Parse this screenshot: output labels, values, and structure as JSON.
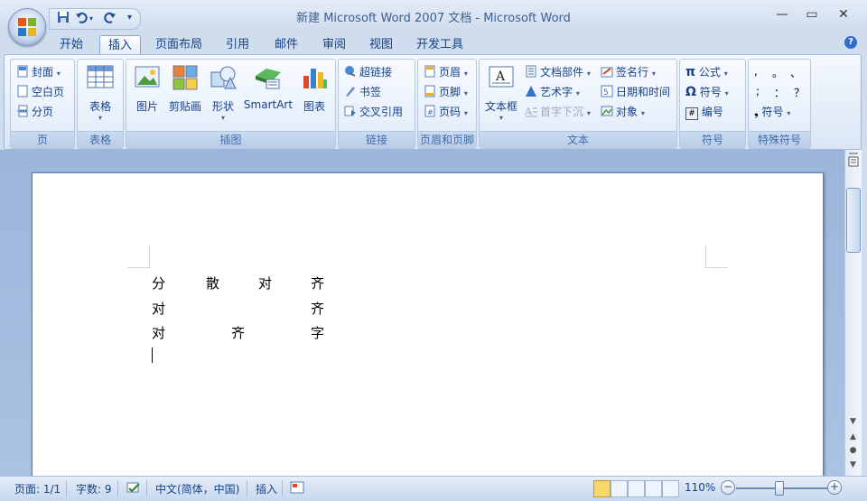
{
  "app": {
    "title": "新建 Microsoft Word 2007 文档 - Microsoft Word"
  },
  "qat": {
    "customize_glyph": "▾"
  },
  "window": {
    "minimize": "—",
    "restore": "▭",
    "close": "✕"
  },
  "tabs": [
    {
      "label": "开始"
    },
    {
      "label": "插入",
      "active": true
    },
    {
      "label": "页面布局"
    },
    {
      "label": "引用"
    },
    {
      "label": "邮件"
    },
    {
      "label": "审阅"
    },
    {
      "label": "视图"
    },
    {
      "label": "开发工具"
    }
  ],
  "help_glyph": "?",
  "ribbon": {
    "page": {
      "label": "页",
      "items": [
        "封面",
        "空白页",
        "分页"
      ]
    },
    "table": {
      "label": "表格",
      "button": "表格"
    },
    "illustrations": {
      "label": "插图",
      "buttons": [
        "图片",
        "剪贴画",
        "形状",
        "SmartArt",
        "图表"
      ]
    },
    "links": {
      "label": "链接",
      "items": [
        "超链接",
        "书签",
        "交叉引用"
      ]
    },
    "header_footer": {
      "label": "页眉和页脚",
      "items": [
        "页眉",
        "页脚",
        "页码"
      ]
    },
    "text": {
      "label": "文本",
      "textbox": "文本框",
      "items": [
        "文档部件",
        "艺术字",
        "首字下沉",
        "签名行",
        "日期和时间",
        "对象"
      ]
    },
    "symbols": {
      "label": "符号",
      "items": [
        "公式",
        "符号",
        "编号"
      ],
      "pi": "π",
      "omega": "Ω",
      "numbering_glyph": "#"
    },
    "special": {
      "label": "特殊符号",
      "row1": [
        ",",
        "。",
        "、"
      ],
      "row2": [
        ";",
        "：",
        "？"
      ],
      "button": "符号",
      "bullet": "❟"
    }
  },
  "document": {
    "lines": [
      [
        "分",
        "散",
        "对",
        "齐"
      ],
      [
        "对",
        "齐"
      ],
      [
        "对",
        "齐",
        "字"
      ]
    ]
  },
  "status": {
    "page": "页面: 1/1",
    "words": "字数: 9",
    "language": "中文(简体，中国)",
    "mode": "插入",
    "zoom": "110%",
    "zoom_minus": "−",
    "zoom_plus": "+"
  }
}
